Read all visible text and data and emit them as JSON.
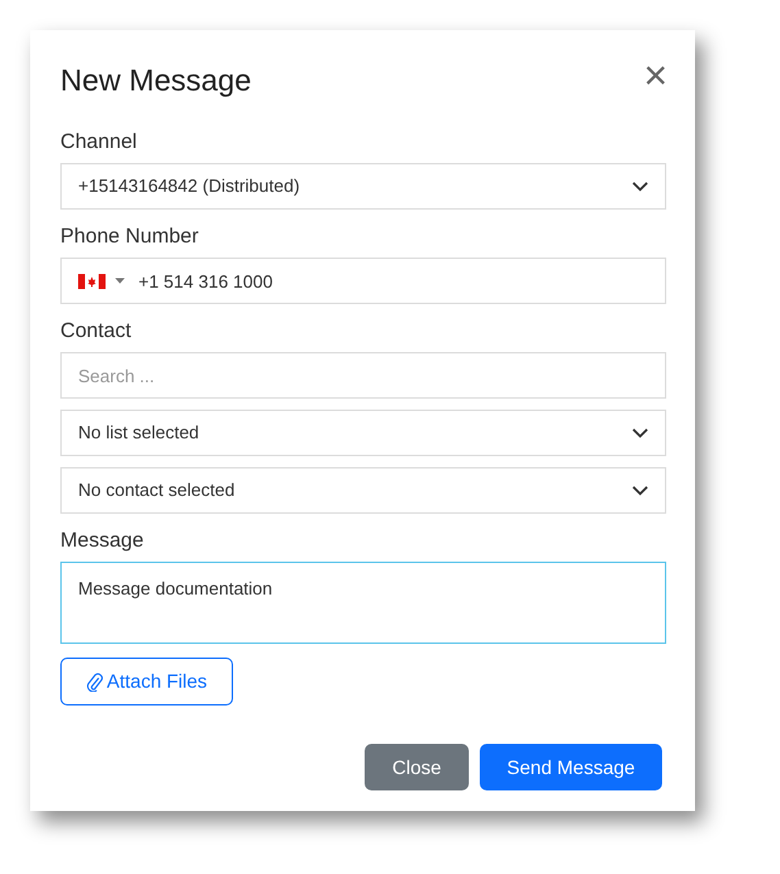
{
  "dialog": {
    "title": "New Message",
    "close_icon": "×",
    "fields": [
      {
        "label": "Channel",
        "kind": "select",
        "value": "+15143164842 (Distributed)"
      },
      {
        "label": "Phone Number",
        "kind": "phone",
        "value": "+1 514 316 1000"
      },
      {
        "label": "Contact",
        "kind": "search",
        "placeholder": "Search ..."
      },
      {
        "kind": "select",
        "value": "No list selected"
      },
      {
        "kind": "select",
        "value": "No contact selected"
      },
      {
        "label": "Message",
        "kind": "textarea",
        "value": "Message documentation",
        "focused": true
      }
    ],
    "attach_button": "Attach Files",
    "buttons": [
      {
        "label": "Close",
        "kind": "secondary"
      },
      {
        "label": "Send Message",
        "kind": "primary"
      }
    ]
  }
}
